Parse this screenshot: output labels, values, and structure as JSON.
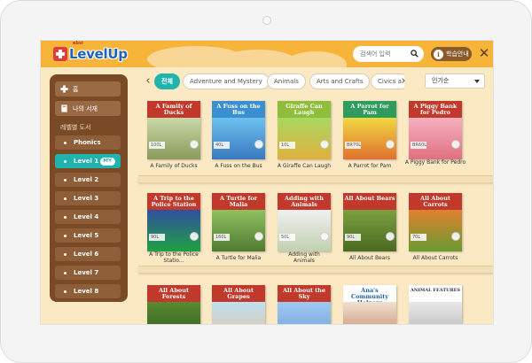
{
  "app": {
    "brand_small": "ebsi",
    "logo_text": "LevelUp"
  },
  "header": {
    "search_placeholder": "검색어 입력",
    "guide_label": "학습안내",
    "close_label": "✕"
  },
  "sidebar": {
    "home_label": "홈",
    "bookshelf_label": "나의 서재",
    "section_label": "레벨별 도서",
    "levels": [
      {
        "label": "Phonics"
      },
      {
        "label": "Level 1",
        "badge": "MY",
        "active": true
      },
      {
        "label": "Level 2"
      },
      {
        "label": "Level 3"
      },
      {
        "label": "Level 4"
      },
      {
        "label": "Level 5"
      },
      {
        "label": "Level 6"
      },
      {
        "label": "Level 7"
      },
      {
        "label": "Level 8"
      }
    ]
  },
  "tabs": {
    "prev": "‹",
    "next": "›",
    "items": [
      {
        "label": "전체",
        "active": true
      },
      {
        "label": "Adventure and Mystery"
      },
      {
        "label": "Animals"
      },
      {
        "label": "Arts and Crafts"
      },
      {
        "label": "Civics a"
      }
    ]
  },
  "sort": {
    "value": "인기순"
  },
  "books": [
    {
      "cover": "A Family of Ducks",
      "title": "A Family of Ducks",
      "level": "100L",
      "color": "#c0392b"
    },
    {
      "cover": "A Fuss on the Bus",
      "title": "A Fuss on the Bus",
      "level": "40L",
      "color": "#3a8fd1"
    },
    {
      "cover": "Giraffe Can Laugh",
      "title": "A Giraffe Can Laugh",
      "level": "10L",
      "color": "#8fbf3a"
    },
    {
      "cover": "A Parrot for Pam",
      "title": "A Parrot for Pam",
      "level": "BR70L",
      "color": "#2d9c5c"
    },
    {
      "cover": "A Piggy Bank for Pedro",
      "title": "A Piggy Bank for Pedro",
      "level": "BR60L",
      "color": "#c0392b"
    },
    {
      "cover": "A Trip to the Police Station",
      "title": "A Trip to the Police Statio...",
      "level": "90L",
      "color": "#c0392b"
    },
    {
      "cover": "A Turtle for Malia",
      "title": "A Turtle for Malia",
      "level": "160L",
      "color": "#c0392b"
    },
    {
      "cover": "Adding with Animals",
      "title": "Adding with Animals",
      "level": "50L",
      "color": "#c0392b"
    },
    {
      "cover": "All About Bears",
      "title": "All About Bears",
      "level": "90L",
      "color": "#c0392b"
    },
    {
      "cover": "All About Carrots",
      "title": "All About Carrots",
      "level": "70L",
      "color": "#c0392b"
    },
    {
      "cover": "All About Forests",
      "title": "",
      "level": "",
      "color": "#c0392b"
    },
    {
      "cover": "All About Grapes",
      "title": "",
      "level": "",
      "color": "#c0392b"
    },
    {
      "cover": "All About the Sky",
      "title": "",
      "level": "",
      "color": "#c0392b"
    },
    {
      "cover": "Ana's Community Helpers",
      "title": "",
      "level": "",
      "color": "#ffffff"
    },
    {
      "cover": "ANIMAL FEATURES",
      "title": "",
      "level": "",
      "color": "#ffffff"
    }
  ],
  "colors": {
    "accent": "#21b3ad",
    "header": "#f6b53a",
    "sidebar": "#7a4a26"
  }
}
